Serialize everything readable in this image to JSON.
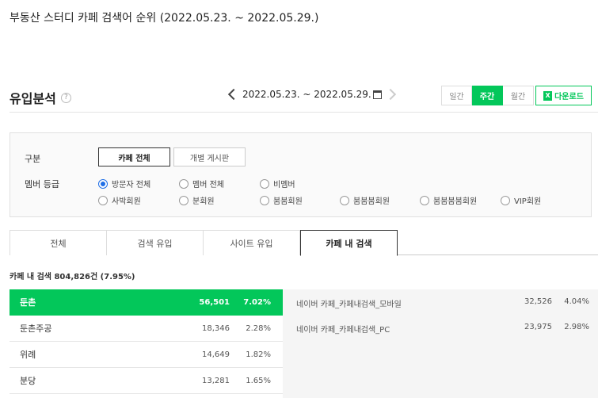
{
  "caption": "부동산 스터디 카페 검색어 순위 (2022.05.23. ~ 2022.05.29.)",
  "header": {
    "title": "유입분석",
    "help": "?",
    "date_range": "2022.05.23. ~ 2022.05.29."
  },
  "period": {
    "daily": "일간",
    "weekly": "주간",
    "monthly": "월간"
  },
  "download_label": "다운로드",
  "filter": {
    "category_label": "구분",
    "category_options": [
      "카페 전체",
      "개별 게시판"
    ],
    "member_label": "멤버 등급",
    "member_options": [
      "방문자 전체",
      "멤버 전체",
      "비멤버",
      "사박회원",
      "분회원",
      "붐붐회원",
      "붐붐붐회원",
      "붐붐붐붐회원",
      "VIP회원"
    ]
  },
  "tabs": [
    "전체",
    "검색 유입",
    "사이트 유입",
    "카페 내 검색"
  ],
  "summary": "카페 내 검색 804,826건 (7.95%)",
  "rankings": [
    {
      "name": "둔촌",
      "count": "56,501",
      "ratio": "7.02%"
    },
    {
      "name": "둔촌주공",
      "count": "18,346",
      "ratio": "2.28%"
    },
    {
      "name": "위례",
      "count": "14,649",
      "ratio": "1.82%"
    },
    {
      "name": "분당",
      "count": "13,281",
      "ratio": "1.65%"
    }
  ],
  "detail": [
    {
      "name": "네이버 카페_카페내검색_모바일",
      "count": "32,526",
      "ratio": "4.04%"
    },
    {
      "name": "네이버 카페_카페내검색_PC",
      "count": "23,975",
      "ratio": "2.98%"
    }
  ],
  "colors": {
    "accent": "#03c75a",
    "radio": "#1e6ee6"
  }
}
